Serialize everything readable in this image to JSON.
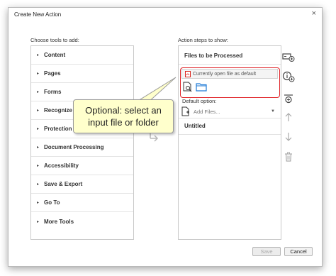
{
  "window": {
    "title": "Create New Action",
    "close_glyph": "×"
  },
  "tools_panel": {
    "label": "Choose tools to add:",
    "items": [
      {
        "label": "Content"
      },
      {
        "label": "Pages"
      },
      {
        "label": "Forms"
      },
      {
        "label": "Recognize"
      },
      {
        "label": "Protection"
      },
      {
        "label": "Document Processing"
      },
      {
        "label": "Accessibility"
      },
      {
        "label": "Save & Export"
      },
      {
        "label": "Go To"
      },
      {
        "label": "More Tools"
      }
    ]
  },
  "steps_panel": {
    "label": "Action steps to show:",
    "files_heading": "Files to be Processed",
    "current_file_option": "Currently open file as default",
    "default_option_label": "Default option:",
    "add_files_placeholder": "Add Files...",
    "untitled_heading": "Untitled"
  },
  "callout": {
    "text_line1": "Optional: select an",
    "text_line2": "input file or folder"
  },
  "buttons": {
    "save": "Save",
    "cancel": "Cancel"
  },
  "colors": {
    "highlight": "#e0262b",
    "callout_bg": "#ffffcc",
    "folder_blue": "#1f7ad6",
    "pdf_red": "#d9241c"
  },
  "side_icons": [
    "add-instruction-icon",
    "add-info-icon",
    "add-step-icon",
    "move-up-icon",
    "move-down-icon",
    "delete-icon"
  ]
}
